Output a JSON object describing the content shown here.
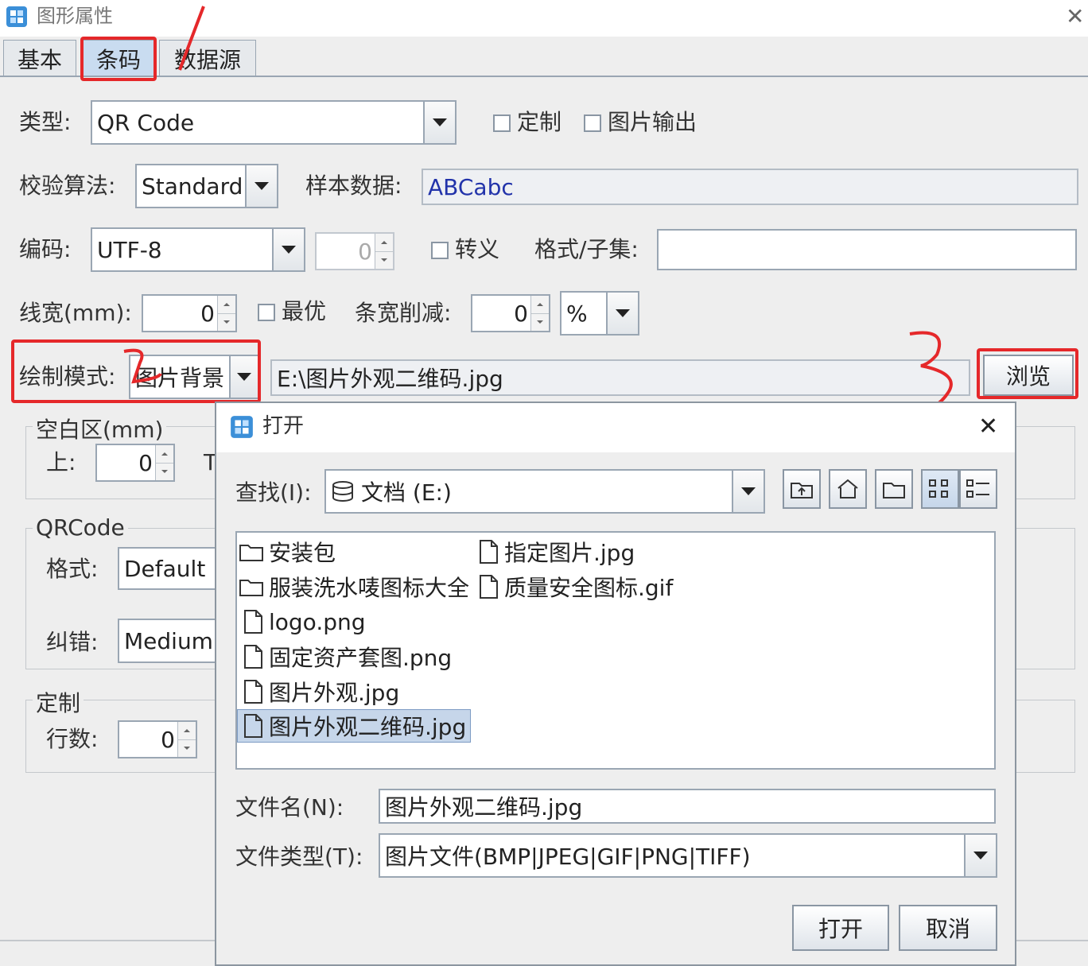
{
  "window": {
    "title": "图形属性",
    "close_glyph": "✕"
  },
  "tabs": [
    {
      "label": "基本"
    },
    {
      "label": "条码"
    },
    {
      "label": "数据源"
    }
  ],
  "form": {
    "type_label": "类型:",
    "type_value": "QR Code",
    "custom_label": "定制",
    "image_output_label": "图片输出",
    "checksum_label": "校验算法:",
    "checksum_value": "Standard",
    "sample_label": "样本数据:",
    "sample_value": "ABCabc",
    "encoding_label": "编码:",
    "encoding_value": "UTF-8",
    "encoding_num": "0",
    "escape_label": "转义",
    "format_subset_label": "格式/子集:",
    "format_subset_value": "",
    "linewidth_label": "线宽(mm):",
    "linewidth_value": "0",
    "optimal_label": "最优",
    "bar_reduce_label": "条宽削减:",
    "bar_reduce_value": "0",
    "bar_reduce_unit": "%",
    "draw_mode_label": "绘制模式:",
    "draw_mode_value": "图片背景",
    "draw_path_value": "E:\\图片外观二维码.jpg",
    "browse_label": "浏览"
  },
  "groups": {
    "quiet_zone": {
      "title": "空白区(mm)",
      "top_label": "上:",
      "top_value": "0",
      "next_label": "T"
    },
    "qrcode": {
      "title": "QRCode",
      "format_label": "格式:",
      "format_value": "Default",
      "ecc_label": "纠错:",
      "ecc_value": "Medium"
    },
    "custom": {
      "title": "定制",
      "rows_label": "行数:",
      "rows_value": "0"
    }
  },
  "annotations": {
    "mark1": "1",
    "mark2": "2",
    "mark3": "3",
    "color": "#e5282a"
  },
  "dialog": {
    "title": "打开",
    "close_glyph": "✕",
    "lookin_label": "查找(I):",
    "lookin_value": "文档 (E:)",
    "toolbar_icons": [
      "up-folder-icon",
      "home-icon",
      "new-folder-icon",
      "list-view-icon",
      "details-view-icon"
    ],
    "files": [
      {
        "name": "安装包",
        "type": "folder"
      },
      {
        "name": "服装洗水唛图标大全",
        "type": "folder"
      },
      {
        "name": "logo.png",
        "type": "file"
      },
      {
        "name": "固定资产套图.png",
        "type": "file"
      },
      {
        "name": "图片外观.jpg",
        "type": "file"
      },
      {
        "name": "图片外观二维码.jpg",
        "type": "file",
        "selected": true
      },
      {
        "name": "指定图片.jpg",
        "type": "file"
      },
      {
        "name": "质量安全图标.gif",
        "type": "file"
      }
    ],
    "filename_label": "文件名(N):",
    "filename_value": "图片外观二维码.jpg",
    "filetype_label": "文件类型(T):",
    "filetype_value": "图片文件(BMP|JPEG|GIF|PNG|TIFF)",
    "open_button": "打开",
    "cancel_button": "取消"
  }
}
